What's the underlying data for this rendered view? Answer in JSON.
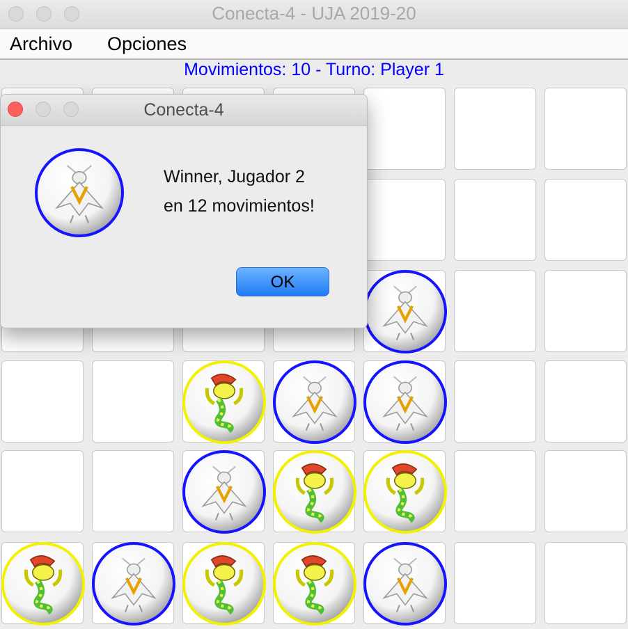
{
  "window": {
    "title": "Conecta-4 - UJA 2019-20"
  },
  "menu": {
    "items": [
      "Archivo",
      "Opciones"
    ]
  },
  "status": {
    "text": "Movimientos: 10 - Turno: Player 1"
  },
  "board": {
    "rows": 6,
    "cols": 7,
    "cells": [
      [
        "empty",
        "empty",
        "empty",
        "empty",
        "empty",
        "empty",
        "empty"
      ],
      [
        "empty",
        "empty",
        "empty",
        "empty",
        "empty",
        "empty",
        "empty"
      ],
      [
        "empty",
        "empty",
        "empty",
        "empty",
        "blue",
        "empty",
        "empty"
      ],
      [
        "empty",
        "empty",
        "yellow",
        "blue",
        "blue",
        "empty",
        "empty"
      ],
      [
        "empty",
        "empty",
        "blue",
        "yellow",
        "yellow",
        "empty",
        "empty"
      ],
      [
        "yellow",
        "blue",
        "yellow",
        "yellow",
        "blue",
        "empty",
        "empty"
      ]
    ],
    "piece_colors": {
      "blue": "#1414ff",
      "yellow": "#f2f200"
    }
  },
  "dialog": {
    "title": "Conecta-4",
    "message_line1": "Winner, Jugador 2",
    "message_line2": "en 12 movimientos!",
    "ok_label": "OK",
    "icon": "blue-piece-icon"
  }
}
